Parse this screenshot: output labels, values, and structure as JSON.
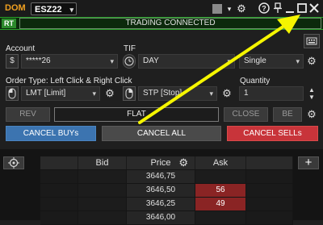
{
  "titlebar": {
    "dom_label": "DOM",
    "symbol": "ESZ22",
    "icons": [
      "color-swatch",
      "settings-gear",
      "help",
      "pin",
      "minimize",
      "maximize",
      "close"
    ]
  },
  "status": {
    "rt_badge": "RT",
    "connection_text": "TRADING CONNECTED",
    "color": "#29a329"
  },
  "account": {
    "label": "Account",
    "value": "*****26"
  },
  "tif": {
    "label": "TIF",
    "value": "DAY"
  },
  "mode": {
    "value": "Single"
  },
  "order_type": {
    "label": "Order Type: Left Click & Right Click",
    "left_value": "LMT [Limit]",
    "right_value": "STP [Stop]"
  },
  "quantity": {
    "label": "Quantity",
    "value": "1"
  },
  "position_row": {
    "rev": "REV",
    "flat": "FLAT",
    "close": "CLOSE",
    "be": "BE"
  },
  "cancel_row": {
    "buys": "CANCEL BUYs",
    "all": "CANCEL ALL",
    "sells": "CANCEL SELLs"
  },
  "ladder": {
    "headers": {
      "bid": "Bid",
      "price": "Price",
      "ask": "Ask"
    },
    "rows": [
      {
        "price": "3646,75",
        "ask": ""
      },
      {
        "price": "3646,50",
        "ask": "56"
      },
      {
        "price": "3646,25",
        "ask": "49"
      },
      {
        "price": "3646,00",
        "ask": ""
      }
    ],
    "ask_color": "#8a2424"
  },
  "annotation": {
    "arrow_color": "#f5f500"
  }
}
